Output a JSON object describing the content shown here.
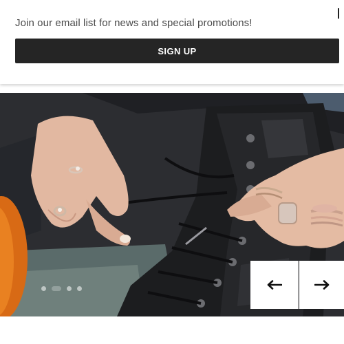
{
  "promo": {
    "message": "Join our email list for news and special promotions!",
    "signup_label": "SIGN UP"
  },
  "hero": {
    "image_alt": "Hands lacing up a black leather boot",
    "slides": 4,
    "active_slide": 2
  },
  "carousel": {
    "prev_icon": "arrow-left-icon",
    "next_icon": "arrow-right-icon"
  },
  "colors": {
    "button_bg": "#252525",
    "button_text": "#ffffff",
    "text_gray": "#4a4a4a"
  }
}
